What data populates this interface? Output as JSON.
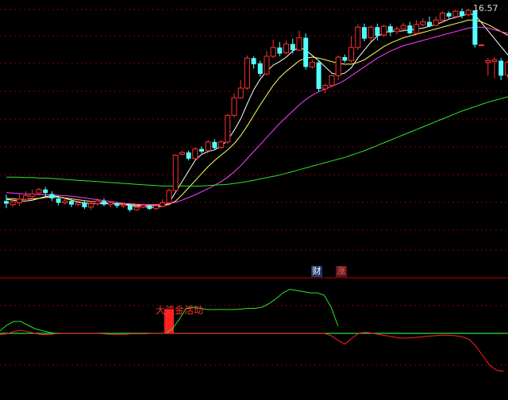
{
  "header": {
    "price_marker": "16.57"
  },
  "badges": {
    "cai": "财",
    "zhang": "涨"
  },
  "indicator": {
    "label": "大资金活动"
  },
  "colors": {
    "up": "#ff3030",
    "down": "#54ffff",
    "ma_white": "#ffffff",
    "ma_yellow": "#ffff60",
    "ma_magenta": "#ff40ff",
    "ma_green": "#30e030",
    "grid": "#8a0000",
    "separator": "#c00000",
    "ind_green": "#30e030",
    "ind_red": "#ff2020",
    "ind_bar": "#ff2020"
  },
  "chart_data": [
    {
      "type": "candlestick",
      "ylim": [
        12.0,
        17.0
      ],
      "candles": [
        [
          12.66,
          12.6,
          12.8,
          12.5
        ],
        [
          12.58,
          12.64,
          12.74,
          12.52
        ],
        [
          12.62,
          12.7,
          12.82,
          12.55
        ],
        [
          12.7,
          12.78,
          12.88,
          12.64
        ],
        [
          12.76,
          12.82,
          12.92,
          12.7
        ],
        [
          12.84,
          12.92,
          12.96,
          12.78
        ],
        [
          12.92,
          12.84,
          12.98,
          12.76
        ],
        [
          12.82,
          12.72,
          12.88,
          12.66
        ],
        [
          12.72,
          12.62,
          12.78,
          12.56
        ],
        [
          12.62,
          12.66,
          12.74,
          12.58
        ],
        [
          12.66,
          12.58,
          12.72,
          12.52
        ],
        [
          12.58,
          12.62,
          12.7,
          12.54
        ],
        [
          12.62,
          12.52,
          12.68,
          12.48
        ],
        [
          12.52,
          12.6,
          12.66,
          12.46
        ],
        [
          12.6,
          12.66,
          12.72,
          12.55
        ],
        [
          12.66,
          12.58,
          12.72,
          12.54
        ],
        [
          12.58,
          12.62,
          12.66,
          12.52
        ],
        [
          12.6,
          12.55,
          12.64,
          12.5
        ],
        [
          12.55,
          12.58,
          12.62,
          12.5
        ],
        [
          12.56,
          12.46,
          12.6,
          12.42
        ],
        [
          12.46,
          12.52,
          12.56,
          12.44
        ],
        [
          12.52,
          12.56,
          12.6,
          12.5
        ],
        [
          12.55,
          12.48,
          12.58,
          12.46
        ],
        [
          12.49,
          12.55,
          12.6,
          12.46
        ],
        [
          12.54,
          12.62,
          12.7,
          12.52
        ],
        [
          12.62,
          12.9,
          12.94,
          12.6
        ],
        [
          12.9,
          13.7,
          13.72,
          12.88
        ],
        [
          13.72,
          13.76,
          13.8,
          13.7
        ],
        [
          13.76,
          13.62,
          13.8,
          13.58
        ],
        [
          13.62,
          13.84,
          13.88,
          13.6
        ],
        [
          13.84,
          13.78,
          13.9,
          13.74
        ],
        [
          13.8,
          14.0,
          14.04,
          13.78
        ],
        [
          14.0,
          13.86,
          14.06,
          13.82
        ],
        [
          13.88,
          14.0,
          14.04,
          13.84
        ],
        [
          14.0,
          14.6,
          14.64,
          13.96
        ],
        [
          14.6,
          15.0,
          15.1,
          14.56
        ],
        [
          15.0,
          15.22,
          15.4,
          14.98
        ],
        [
          15.22,
          15.9,
          15.96,
          15.18
        ],
        [
          15.9,
          15.76,
          15.94,
          15.66
        ],
        [
          15.78,
          15.54,
          15.84,
          15.48
        ],
        [
          15.54,
          15.94,
          16.06,
          15.5
        ],
        [
          15.94,
          16.14,
          16.32,
          15.9
        ],
        [
          16.14,
          16.0,
          16.26,
          15.94
        ],
        [
          16.02,
          16.22,
          16.3,
          15.98
        ],
        [
          16.22,
          16.08,
          16.34,
          16.0
        ],
        [
          16.08,
          16.36,
          16.52,
          16.06
        ],
        [
          16.36,
          15.7,
          16.46,
          15.64
        ],
        [
          15.7,
          15.8,
          15.86,
          15.66
        ],
        [
          15.8,
          15.2,
          15.84,
          15.14
        ],
        [
          15.2,
          15.28,
          15.32,
          15.1
        ],
        [
          15.28,
          15.5,
          15.54,
          15.24
        ],
        [
          15.5,
          15.92,
          15.96,
          15.4
        ],
        [
          15.92,
          15.84,
          15.98,
          15.8
        ],
        [
          15.84,
          16.14,
          16.4,
          15.8
        ],
        [
          16.14,
          16.6,
          16.66,
          16.08
        ],
        [
          16.6,
          16.34,
          16.68,
          16.28
        ],
        [
          16.36,
          16.6,
          16.64,
          16.28
        ],
        [
          16.6,
          16.4,
          16.68,
          16.3
        ],
        [
          16.42,
          16.62,
          16.66,
          16.38
        ],
        [
          16.62,
          16.48,
          16.68,
          16.4
        ],
        [
          16.5,
          16.56,
          16.62,
          16.44
        ],
        [
          16.56,
          16.64,
          16.7,
          16.52
        ],
        [
          16.64,
          16.46,
          16.72,
          16.44
        ],
        [
          16.46,
          16.66,
          16.76,
          16.44
        ],
        [
          16.66,
          16.72,
          16.8,
          16.62
        ],
        [
          16.72,
          16.62,
          16.84,
          16.6
        ],
        [
          16.64,
          16.76,
          16.84,
          16.62
        ],
        [
          16.76,
          16.92,
          16.96,
          16.7
        ],
        [
          16.92,
          16.84,
          16.96,
          16.78
        ],
        [
          16.84,
          16.96,
          17.0,
          16.8
        ],
        [
          16.96,
          16.86,
          17.02,
          16.8
        ],
        [
          16.88,
          16.98,
          17.02,
          16.84
        ],
        [
          16.98,
          16.2,
          16.99,
          16.14
        ],
        [
          16.2,
          16.2,
          16.2,
          16.2
        ],
        [
          15.8,
          15.84,
          15.9,
          15.5
        ],
        [
          15.82,
          15.86,
          15.92,
          15.44
        ],
        [
          15.84,
          15.5,
          15.9,
          15.4
        ],
        [
          15.52,
          15.8,
          15.84,
          15.46
        ],
        [
          15.8,
          15.9,
          15.96,
          15.7
        ]
      ],
      "ma": [
        {
          "color": "white",
          "values": [
            12.7,
            12.68,
            12.66,
            12.66,
            12.68,
            12.72,
            12.76,
            12.78,
            12.76,
            12.72,
            12.68,
            12.64,
            12.62,
            12.6,
            12.6,
            12.6,
            12.6,
            12.6,
            12.59,
            12.56,
            12.54,
            12.54,
            12.52,
            12.52,
            12.54,
            12.62,
            12.86,
            13.1,
            13.34,
            13.58,
            13.72,
            13.78,
            13.82,
            13.9,
            14.04,
            14.26,
            14.52,
            14.86,
            15.18,
            15.42,
            15.6,
            15.74,
            15.82,
            15.92,
            16.06,
            16.14,
            16.08,
            15.96,
            15.84,
            15.7,
            15.56,
            15.52,
            15.56,
            15.68,
            15.9,
            16.08,
            16.26,
            16.4,
            16.46,
            16.52,
            16.5,
            16.52,
            16.54,
            16.56,
            16.58,
            16.62,
            16.66,
            16.72,
            16.78,
            16.82,
            16.86,
            16.9,
            16.88,
            16.7,
            16.52,
            16.34,
            16.16,
            15.98,
            15.84
          ]
        },
        {
          "color": "yellow",
          "values": [
            12.72,
            12.71,
            12.7,
            12.7,
            12.71,
            12.72,
            12.74,
            12.75,
            12.75,
            12.73,
            12.71,
            12.69,
            12.67,
            12.65,
            12.64,
            12.62,
            12.61,
            12.6,
            12.59,
            12.58,
            12.57,
            12.56,
            12.56,
            12.56,
            12.56,
            12.58,
            12.66,
            12.8,
            12.96,
            13.12,
            13.28,
            13.44,
            13.58,
            13.7,
            13.82,
            13.96,
            14.14,
            14.36,
            14.6,
            14.84,
            15.06,
            15.28,
            15.46,
            15.6,
            15.72,
            15.84,
            15.9,
            15.92,
            15.9,
            15.86,
            15.82,
            15.78,
            15.76,
            15.76,
            15.8,
            15.86,
            15.96,
            16.06,
            16.16,
            16.24,
            16.3,
            16.36,
            16.4,
            16.44,
            16.48,
            16.52,
            16.56,
            16.6,
            16.64,
            16.68,
            16.72,
            16.76,
            16.76,
            16.72,
            16.66,
            16.58,
            16.5,
            16.42,
            16.36
          ]
        },
        {
          "color": "magenta",
          "values": [
            12.85,
            12.84,
            12.83,
            12.82,
            12.81,
            12.81,
            12.8,
            12.8,
            12.79,
            12.78,
            12.77,
            12.75,
            12.73,
            12.71,
            12.69,
            12.67,
            12.65,
            12.63,
            12.61,
            12.6,
            12.59,
            12.58,
            12.58,
            12.58,
            12.58,
            12.6,
            12.63,
            12.68,
            12.74,
            12.8,
            12.87,
            12.94,
            13.02,
            13.1,
            13.2,
            13.32,
            13.46,
            13.62,
            13.78,
            13.94,
            14.1,
            14.26,
            14.42,
            14.56,
            14.7,
            14.84,
            14.96,
            15.06,
            15.14,
            15.2,
            15.26,
            15.32,
            15.4,
            15.5,
            15.6,
            15.7,
            15.8,
            15.9,
            15.98,
            16.06,
            16.12,
            16.18,
            16.22,
            16.26,
            16.3,
            16.34,
            16.38,
            16.42,
            16.46,
            16.5,
            16.54,
            16.58,
            16.6,
            16.6,
            16.58,
            16.54,
            16.5,
            16.46,
            16.42
          ]
        },
        {
          "color": "green",
          "values": [
            13.2,
            13.2,
            13.2,
            13.19,
            13.19,
            13.18,
            13.18,
            13.17,
            13.16,
            13.15,
            13.14,
            13.13,
            13.12,
            13.11,
            13.1,
            13.09,
            13.08,
            13.07,
            13.06,
            13.05,
            13.04,
            13.03,
            13.02,
            13.01,
            13.0,
            13.0,
            13.0,
            13.0,
            13.0,
            13.0,
            13.0,
            13.01,
            13.02,
            13.03,
            13.04,
            13.06,
            13.08,
            13.1,
            13.13,
            13.16,
            13.19,
            13.22,
            13.25,
            13.29,
            13.33,
            13.37,
            13.41,
            13.45,
            13.49,
            13.53,
            13.57,
            13.61,
            13.65,
            13.7,
            13.75,
            13.8,
            13.86,
            13.92,
            13.98,
            14.04,
            14.1,
            14.16,
            14.22,
            14.28,
            14.34,
            14.4,
            14.46,
            14.52,
            14.58,
            14.64,
            14.7,
            14.75,
            14.8,
            14.85,
            14.9,
            14.94,
            14.98,
            15.02,
            15.06
          ]
        }
      ]
    },
    {
      "type": "line",
      "ylim": [
        -2.0,
        2.0
      ],
      "zero": 0.0,
      "series": [
        {
          "color": "green",
          "values": [
            0.1,
            0.35,
            0.5,
            0.5,
            0.35,
            0.2,
            0.12,
            0.05,
            0.0,
            0.0,
            0.0,
            0.0,
            0.0,
            0.0,
            0.0,
            0.0,
            0.0,
            0.0,
            0.0,
            0.0,
            0.0,
            0.0,
            0.0,
            0.0,
            0.0,
            0.2,
            0.6,
            1.05,
            1.1,
            1.05,
            1.0,
            1.0,
            1.0,
            1.0,
            1.0,
            1.02,
            1.05,
            1.05,
            1.1,
            1.25,
            1.45,
            1.7,
            1.85,
            1.8,
            1.75,
            1.7,
            1.7,
            1.6,
            1.1,
            0.3
          ]
        },
        {
          "color": "red",
          "values": [
            -0.05,
            -0.02,
            0.08,
            0.12,
            0.08,
            0.0,
            -0.05,
            -0.05,
            -0.02,
            0.0,
            0.0,
            0.0,
            0.0,
            0.0,
            0.0,
            -0.02,
            -0.04,
            -0.04,
            -0.04,
            -0.02,
            -0.02,
            -0.02,
            0.0,
            0.0,
            0.0,
            0.0,
            0.0,
            0.0,
            0.0,
            0.0,
            0.0,
            0.0,
            0.0,
            0.0,
            0.0,
            0.0,
            0.0,
            0.0,
            0.0,
            0.0,
            0.0,
            0.0,
            0.0,
            0.0,
            0.0,
            0.0,
            0.0,
            0.0,
            -0.1,
            -0.3,
            -0.45,
            -0.2,
            0.0,
            0.05,
            0.0,
            -0.05,
            -0.1,
            -0.15,
            -0.2,
            -0.2,
            -0.18,
            -0.15,
            -0.12,
            -0.1,
            -0.08,
            -0.08,
            -0.1,
            -0.15,
            -0.25,
            -0.55,
            -0.95,
            -1.35,
            -1.55,
            -1.6
          ]
        }
      ],
      "bars": [
        {
          "index": 25,
          "value": 1.0
        }
      ]
    }
  ]
}
